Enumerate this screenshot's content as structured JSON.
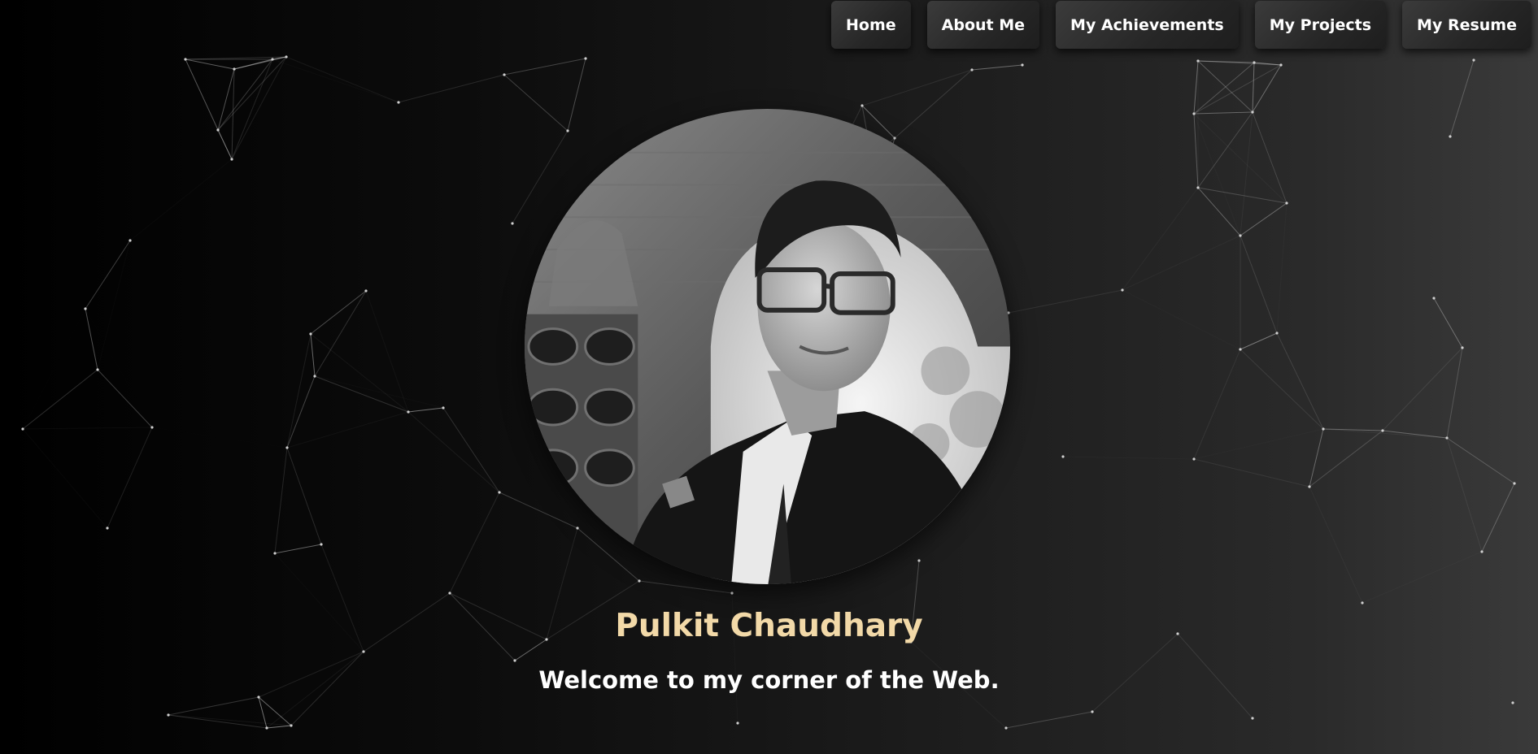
{
  "nav": {
    "items": [
      {
        "label": "Home"
      },
      {
        "label": "About Me"
      },
      {
        "label": "My Achievements"
      },
      {
        "label": "My Projects"
      },
      {
        "label": "My Resume"
      }
    ]
  },
  "hero": {
    "avatar_icon": "profile-photo",
    "name": "Pulkit Chaudhary",
    "tagline": "Welcome to my corner of the Web."
  },
  "colors": {
    "name_accent": "#f2d9a8",
    "text": "#ffffff",
    "network_lines": "#bfbfbf"
  }
}
